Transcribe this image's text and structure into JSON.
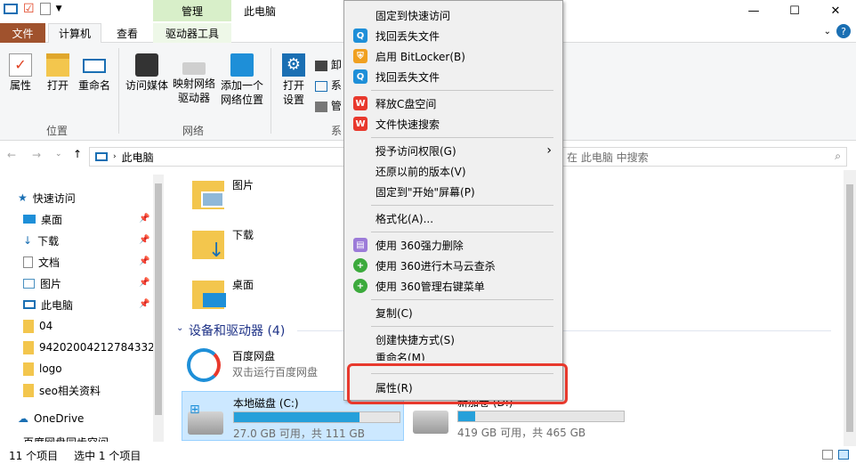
{
  "window": {
    "title": "此电脑",
    "context_tab": "管理"
  },
  "tabs": [
    "文件",
    "计算机",
    "查看",
    "驱动器工具"
  ],
  "ribbon": {
    "buttons": [
      {
        "label": "属性"
      },
      {
        "label": "打开"
      },
      {
        "label": "重命名"
      },
      {
        "label": "访问媒体"
      },
      {
        "label": "映射网络\n驱动器"
      },
      {
        "label": "添加一个\n网络位置"
      },
      {
        "label": "打开\n设置"
      }
    ],
    "small": [
      "卸",
      "系",
      "管"
    ],
    "groups": [
      "位置",
      "网络",
      "系"
    ]
  },
  "address": {
    "path": "此电脑",
    "search_placeholder": "在 此电脑 中搜索"
  },
  "nav": {
    "quick": "快速访问",
    "items": [
      "桌面",
      "下载",
      "文档",
      "图片",
      "此电脑",
      "04",
      "94202004212784332",
      "logo",
      "seo相关资料"
    ],
    "onedrive": "OneDrive",
    "cut_item": "百度网盘同步空间"
  },
  "folders": [
    "图片",
    "下载",
    "桌面"
  ],
  "devices": {
    "title": "设备和驱动器 (4)",
    "baidu": {
      "name": "百度网盘",
      "desc": "双击运行百度网盘"
    },
    "c": {
      "name": "本地磁盘 (C:)",
      "free": "27.0 GB 可用，共 111 GB",
      "used_fraction": 0.76
    },
    "d": {
      "name": "新加卷 (D:)",
      "free": "419 GB 可用，共 465 GB",
      "used_fraction": 0.1
    }
  },
  "status": {
    "count": "11 个项目",
    "selected": "选中 1 个项目"
  },
  "menu": {
    "items": [
      "固定到快速访问",
      "找回丢失文件",
      "启用 BitLocker(B)",
      "找回丢失文件",
      "释放C盘空间",
      "文件快速搜索",
      "授予访问权限(G)",
      "还原以前的版本(V)",
      "固定到\"开始\"屏幕(P)",
      "格式化(A)...",
      "使用 360强力删除",
      "使用 360进行木马云查杀",
      "使用 360管理右键菜单",
      "复制(C)",
      "创建快捷方式(S)",
      "重命名(M)",
      "属性(R)"
    ]
  },
  "colors": {
    "accent": "#26a0da",
    "file_tab": "#a0522d",
    "highlight": "#e8392d",
    "context": "#d8efc9"
  }
}
